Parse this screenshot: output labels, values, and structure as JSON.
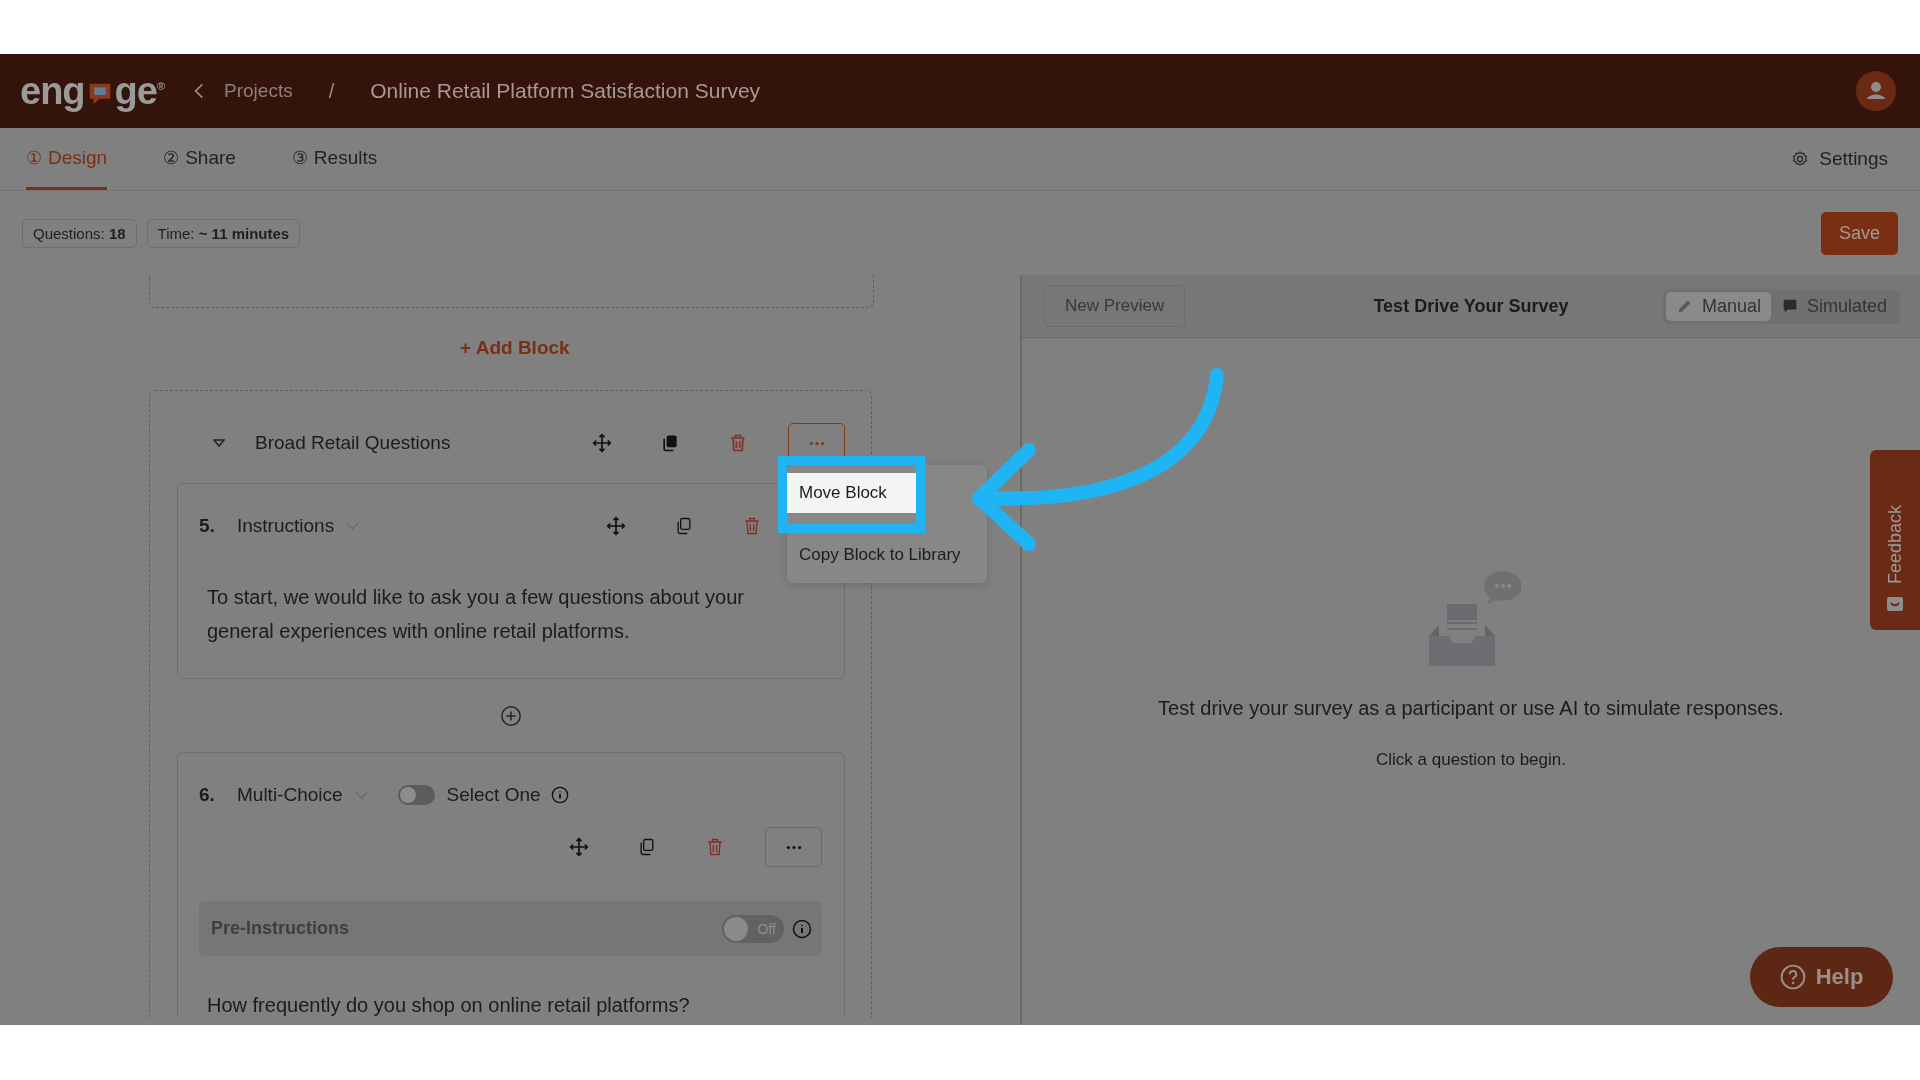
{
  "header": {
    "logo": {
      "before": "eng",
      "after": "ge",
      "mark": "®"
    },
    "back": "Projects",
    "separator": "/",
    "title": "Online Retail Platform Satisfaction Survey"
  },
  "tabs": [
    {
      "number": "①",
      "label": "Design",
      "selected": true
    },
    {
      "number": "②",
      "label": "Share",
      "selected": false
    },
    {
      "number": "③",
      "label": "Results",
      "selected": false
    }
  ],
  "settings": "Settings",
  "stats": [
    "Questions: **18**",
    "Time: **~ 11 minutes**"
  ],
  "save": "Save",
  "add_block": "+ Add Block",
  "block": {
    "title": "Broad Retail Questions",
    "expanded": true,
    "menu": [
      {
        "label": "Move Block",
        "selected": true
      },
      {
        "label": "Copy Block to Library",
        "selected": false
      }
    ],
    "questions": [
      {
        "kind": "instructions",
        "number": "5.",
        "type": "Instructions",
        "text": "To start, we would like to ask you a few questions about your general experiences with online retail platforms."
      },
      {
        "kind": "multi",
        "number": "6.",
        "type": "Multi-Choice",
        "toggle": {
          "label": "Select One",
          "on": false
        },
        "pre_instructions": {
          "label": "Pre-Instructions",
          "state": "Off",
          "on": false
        },
        "text": "How frequently do you shop on online retail platforms?"
      }
    ]
  },
  "preview": {
    "new_button": "New Preview",
    "title": "Test Drive Your Survey",
    "modes": [
      {
        "label": "Manual",
        "selected": true
      },
      {
        "label": "Simulated",
        "selected": false
      }
    ],
    "message": "Test drive your survey as a participant or use AI to simulate responses.",
    "hint": "Click a question to begin."
  },
  "feedback": "Feedback",
  "help": "Help"
}
